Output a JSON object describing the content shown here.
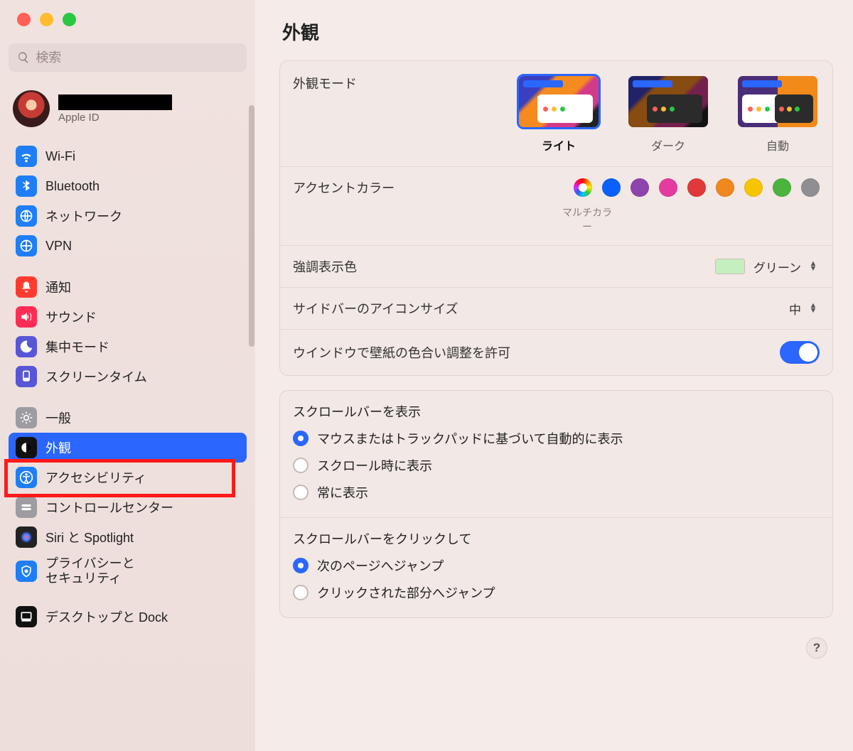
{
  "search": {
    "placeholder": "検索"
  },
  "account": {
    "sub": "Apple ID"
  },
  "sidebar": {
    "groups": [
      {
        "items": [
          {
            "id": "wifi",
            "label": "Wi-Fi",
            "color": "#1f7ef7"
          },
          {
            "id": "bluetooth",
            "label": "Bluetooth",
            "color": "#1f7ef7"
          },
          {
            "id": "network",
            "label": "ネットワーク",
            "color": "#1f7ef7"
          },
          {
            "id": "vpn",
            "label": "VPN",
            "color": "#1f7ef7"
          }
        ]
      },
      {
        "items": [
          {
            "id": "notifications",
            "label": "通知",
            "color": "#ff3b30"
          },
          {
            "id": "sound",
            "label": "サウンド",
            "color": "#ff2d55"
          },
          {
            "id": "focus",
            "label": "集中モード",
            "color": "#5856d6"
          },
          {
            "id": "screentime",
            "label": "スクリーンタイム",
            "color": "#5856d6"
          }
        ]
      },
      {
        "items": [
          {
            "id": "general",
            "label": "一般",
            "color": "#9c9ca1"
          },
          {
            "id": "appearance",
            "label": "外観",
            "color": "#111",
            "selected": true
          },
          {
            "id": "accessibility",
            "label": "アクセシビリティ",
            "color": "#1f7ef7"
          },
          {
            "id": "controlcenter",
            "label": "コントロールセンター",
            "color": "#9c9ca1"
          },
          {
            "id": "siri",
            "label": "Siri と Spotlight",
            "color": "#222"
          },
          {
            "id": "privacy",
            "label": "プライバシーと\nセキュリティ",
            "color": "#1f7ef7"
          }
        ]
      },
      {
        "items": [
          {
            "id": "desktop",
            "label": "デスクトップと Dock",
            "color": "#111"
          }
        ]
      }
    ]
  },
  "page": {
    "title": "外観"
  },
  "appearance": {
    "mode_label": "外観モード",
    "modes": [
      {
        "id": "light",
        "label": "ライト",
        "selected": true
      },
      {
        "id": "dark",
        "label": "ダーク"
      },
      {
        "id": "auto",
        "label": "自動"
      }
    ],
    "accent_label": "アクセントカラー",
    "accent_caption": "マルチカラー",
    "accent_colors": [
      {
        "id": "multi",
        "hex": "multi",
        "selected": true
      },
      {
        "id": "blue",
        "hex": "#0a60ff"
      },
      {
        "id": "purple",
        "hex": "#8e44ad"
      },
      {
        "id": "pink",
        "hex": "#e53ba0"
      },
      {
        "id": "red",
        "hex": "#e0383b"
      },
      {
        "id": "orange",
        "hex": "#f0871f"
      },
      {
        "id": "yellow",
        "hex": "#f7c500"
      },
      {
        "id": "green",
        "hex": "#4cb33f"
      },
      {
        "id": "graphite",
        "hex": "#8e8e93"
      }
    ],
    "highlight_label": "強調表示色",
    "highlight_value": "グリーン",
    "sidebar_icon_label": "サイドバーのアイコンサイズ",
    "sidebar_icon_value": "中",
    "wallpaper_tint_label": "ウインドウで壁紙の色合い調整を許可",
    "wallpaper_tint_on": true
  },
  "scrollbar_show": {
    "title": "スクロールバーを表示",
    "options": [
      {
        "label": "マウスまたはトラックパッドに基づいて自動的に表示",
        "checked": true
      },
      {
        "label": "スクロール時に表示"
      },
      {
        "label": "常に表示"
      }
    ]
  },
  "scrollbar_click": {
    "title": "スクロールバーをクリックして",
    "options": [
      {
        "label": "次のページへジャンプ",
        "checked": true
      },
      {
        "label": "クリックされた部分へジャンプ"
      }
    ]
  },
  "help": "?"
}
